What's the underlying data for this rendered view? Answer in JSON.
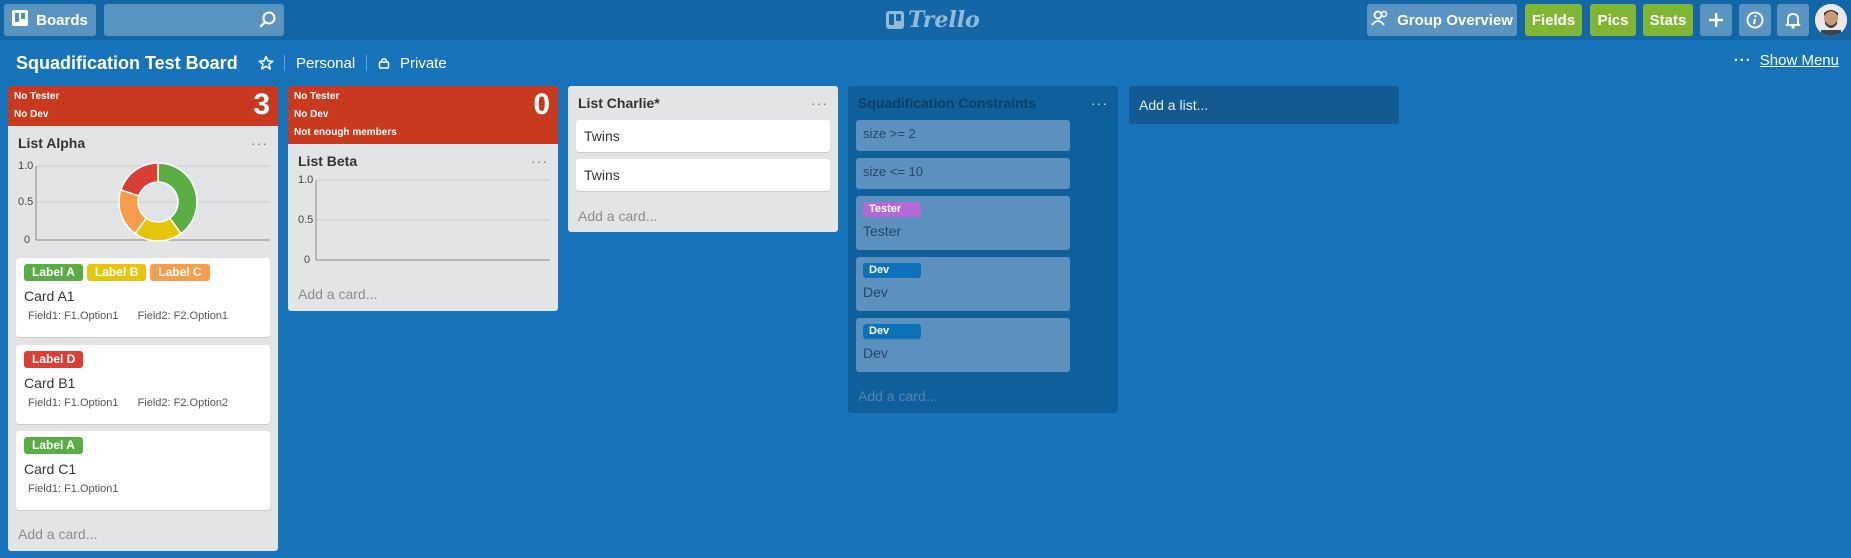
{
  "header": {
    "boards_label": "Boards",
    "search_placeholder": "",
    "logo_text": "Trello",
    "group_overview_label": "Group Overview",
    "fields_label": "Fields",
    "pics_label": "Pics",
    "stats_label": "Stats"
  },
  "board": {
    "title": "Squadification Test Board",
    "team": "Personal",
    "visibility": "Private",
    "show_menu_label": "Show Menu"
  },
  "lists": [
    {
      "name": "List Alpha",
      "banner": [
        "No Tester",
        "No Dev"
      ],
      "count": "3",
      "ticks": [
        "1.0",
        "0.5",
        "0"
      ],
      "cards": [
        {
          "labels": [
            "Label A",
            "Label B",
            "Label C"
          ],
          "title": "Card A1",
          "fields": [
            "Field1: F1.Option1",
            "Field2: F2.Option1"
          ]
        },
        {
          "labels": [
            "Label D"
          ],
          "title": "Card B1",
          "fields": [
            "Field1: F1.Option1",
            "Field2: F2.Option2"
          ]
        },
        {
          "labels": [
            "Label A"
          ],
          "title": "Card C1",
          "fields": [
            "Field1: F1.Option1"
          ]
        }
      ],
      "add_card": "Add a card..."
    },
    {
      "name": "List Beta",
      "banner": [
        "No Tester",
        "No Dev",
        "Not enough members"
      ],
      "count": "0",
      "ticks": [
        "1.0",
        "0.5",
        "0"
      ],
      "add_card": "Add a card..."
    },
    {
      "name": "List Charlie*",
      "cards": [
        {
          "title": "Twins"
        },
        {
          "title": "Twins"
        }
      ],
      "add_card": "Add a card..."
    },
    {
      "name": "Squadification Constraints",
      "cards": [
        {
          "title": "size >= 2"
        },
        {
          "title": "size <= 10"
        },
        {
          "label": "Tester",
          "title": "Tester"
        },
        {
          "label": "Dev",
          "title": "Dev"
        },
        {
          "label": "Dev",
          "title": "Dev"
        }
      ],
      "add_card": "Add a card..."
    }
  ],
  "add_list": "Add a list...",
  "colors": {
    "label_a": "#5aac44",
    "label_b": "#e6c60d",
    "label_c": "#f79e4c",
    "label_d": "#d93f36",
    "tester": "#b668d8",
    "dev": "#0c73ba",
    "banner": "#c9391d"
  },
  "chart_data": {
    "type": "pie",
    "labels": [
      "Label A",
      "Label B",
      "Label C",
      "Label D"
    ],
    "values": [
      2,
      1,
      1,
      1
    ],
    "colors": [
      "#5aac44",
      "#e6c60d",
      "#f79e4c",
      "#d93f36"
    ]
  }
}
